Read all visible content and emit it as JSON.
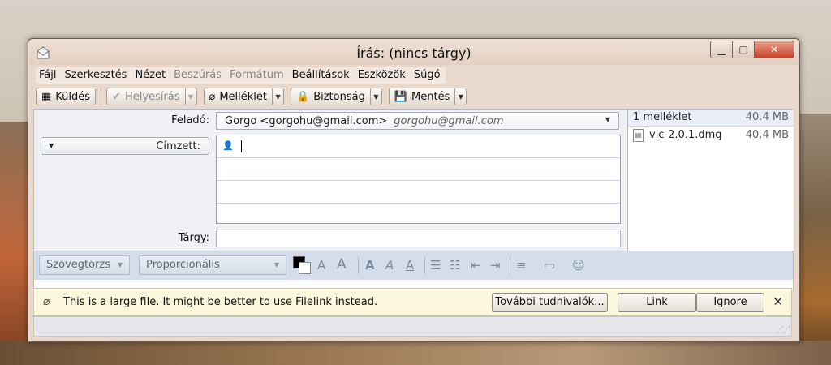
{
  "window": {
    "title": "Írás: (nincs tárgy)"
  },
  "menu": [
    {
      "label": "Fájl",
      "disabled": false
    },
    {
      "label": "Szerkesztés",
      "disabled": false
    },
    {
      "label": "Nézet",
      "disabled": false
    },
    {
      "label": "Beszúrás",
      "disabled": true
    },
    {
      "label": "Formátum",
      "disabled": true
    },
    {
      "label": "Beállítások",
      "disabled": false
    },
    {
      "label": "Eszközök",
      "disabled": false
    },
    {
      "label": "Súgó",
      "disabled": false
    }
  ],
  "toolbar": {
    "send": "Küldés",
    "spell": "Helyesírás",
    "attach": "Melléklet",
    "security": "Biztonság",
    "save": "Mentés"
  },
  "header": {
    "from_label": "Feladó:",
    "from_name": "Gorgo <gorgohu@gmail.com>",
    "from_account": "gorgohu@gmail.com",
    "to_label": "Címzett:",
    "subject_label": "Tárgy:",
    "subject_value": ""
  },
  "attachments": {
    "count_label": "1 melléklet",
    "total_size": "40.4 MB",
    "items": [
      {
        "name": "vlc-2.0.1.dmg",
        "size": "40.4 MB"
      }
    ]
  },
  "format": {
    "paragraph": "Szövegtörzs",
    "font": "Proporcionális"
  },
  "notification": {
    "message": "This is a large file. It might be better to use Filelink instead.",
    "more_info": "További tudnivalók...",
    "link": "Link",
    "ignore": "Ignore"
  }
}
